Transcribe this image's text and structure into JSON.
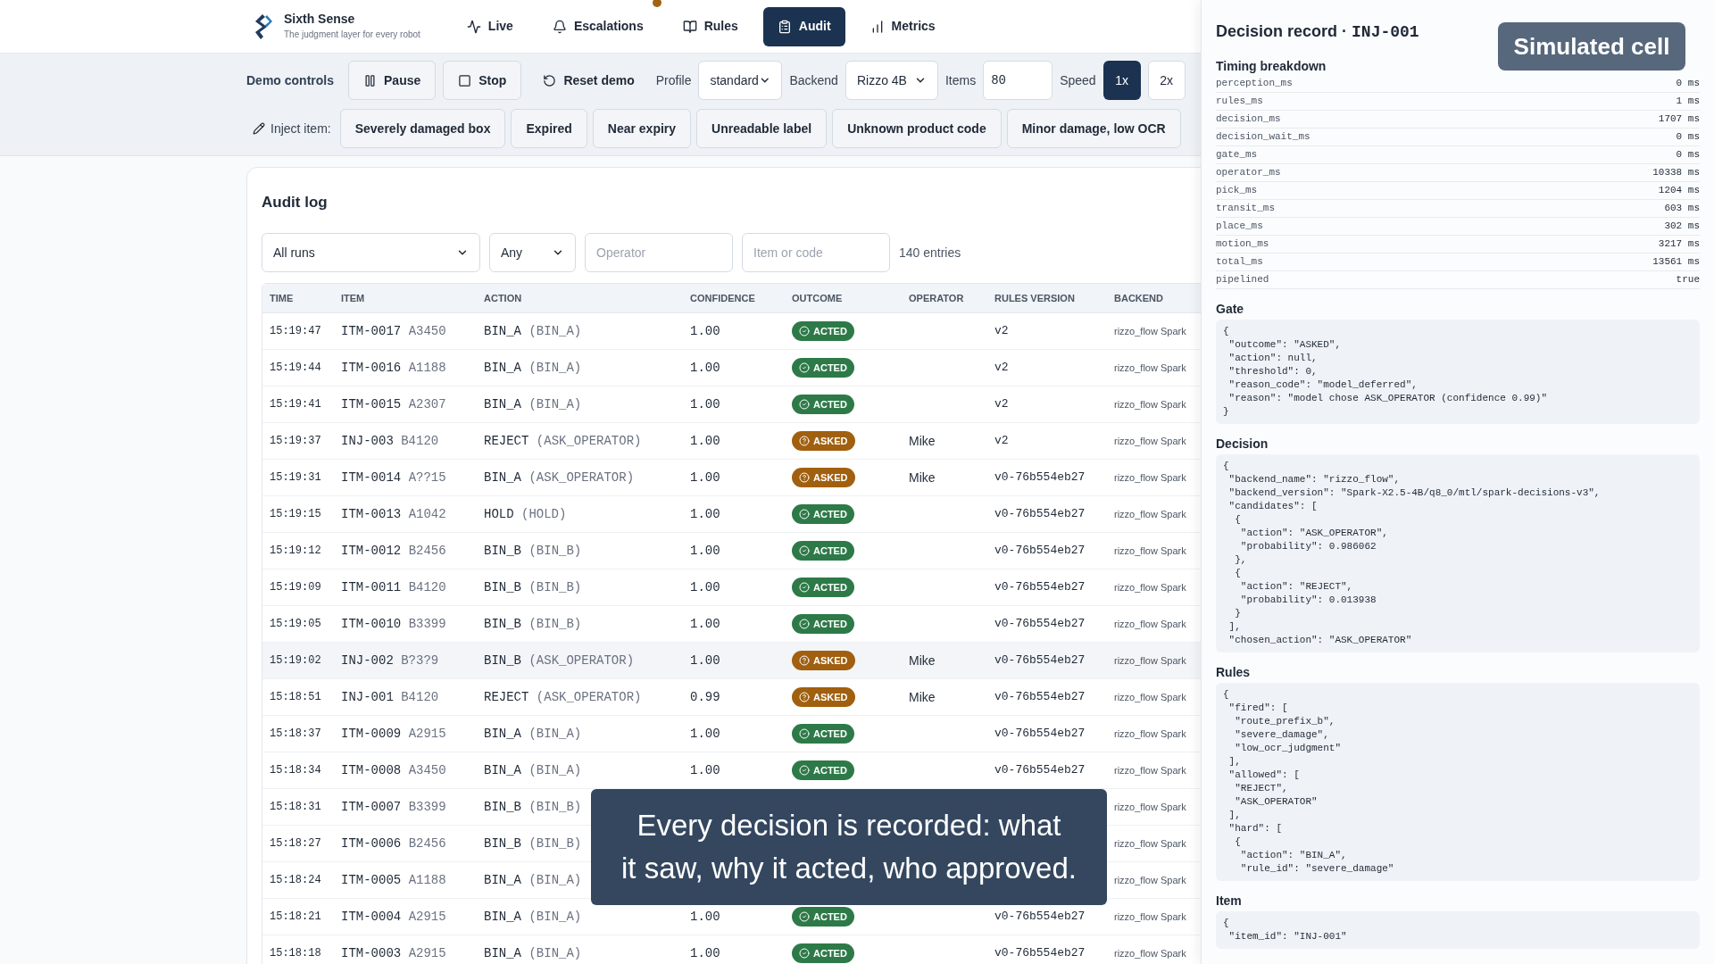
{
  "header": {
    "brand": "Sixth Sense",
    "tagline": "The judgment layer for every robot",
    "tabs": [
      {
        "label": "Live",
        "selected": false,
        "notification": false
      },
      {
        "label": "Escalations",
        "selected": false,
        "notification": true
      },
      {
        "label": "Rules",
        "selected": false,
        "notification": false
      },
      {
        "label": "Audit",
        "selected": true,
        "notification": false
      },
      {
        "label": "Metrics",
        "selected": false,
        "notification": false
      }
    ]
  },
  "demo_controls": {
    "label": "Demo controls",
    "buttons": [
      {
        "label": "Pause",
        "kind": "outlined"
      },
      {
        "label": "Stop",
        "kind": "outlined"
      },
      {
        "label": "Reset demo",
        "kind": "plain"
      }
    ],
    "profile": {
      "label": "Profile",
      "value": "standard"
    },
    "backend": {
      "label": "Backend",
      "value": "Rizzo 4B"
    },
    "items": {
      "label": "Items",
      "value": "80"
    },
    "speed": {
      "label": "Speed",
      "options": [
        {
          "label": "1x",
          "selected": true
        },
        {
          "label": "2x",
          "selected": false
        }
      ]
    },
    "inject": {
      "label": "Inject item:",
      "items": [
        "Severely damaged box",
        "Expired",
        "Near expiry",
        "Unreadable label",
        "Unknown product code",
        "Minor damage, low OCR"
      ]
    }
  },
  "audit_log": {
    "title": "Audit log",
    "filters": {
      "run": "All runs",
      "outcome": "Any",
      "operator_placeholder": "Operator",
      "item_placeholder": "Item or code",
      "count": "140 entries"
    },
    "columns": [
      "TIME",
      "ITEM",
      "ACTION",
      "CONFIDENCE",
      "OUTCOME",
      "OPERATOR",
      "RULES VERSION",
      "BACKEND"
    ],
    "rows": [
      {
        "time": "15:19:47",
        "item": "ITM-0017",
        "code": "A3450",
        "action": "BIN_A",
        "proposed": "(BIN_A)",
        "confidence": "1.00",
        "outcome": "ACTED",
        "kind": "acted",
        "operator": "",
        "rules_version": "v2",
        "backend": "rizzo_flow Spark",
        "selected": false
      },
      {
        "time": "15:19:44",
        "item": "ITM-0016",
        "code": "A1188",
        "action": "BIN_A",
        "proposed": "(BIN_A)",
        "confidence": "1.00",
        "outcome": "ACTED",
        "kind": "acted",
        "operator": "",
        "rules_version": "v2",
        "backend": "rizzo_flow Spark",
        "selected": false
      },
      {
        "time": "15:19:41",
        "item": "ITM-0015",
        "code": "A2307",
        "action": "BIN_A",
        "proposed": "(BIN_A)",
        "confidence": "1.00",
        "outcome": "ACTED",
        "kind": "acted",
        "operator": "",
        "rules_version": "v2",
        "backend": "rizzo_flow Spark",
        "selected": false
      },
      {
        "time": "15:19:37",
        "item": "INJ-003",
        "code": "B4120",
        "action": "REJECT",
        "proposed": "(ASK_OPERATOR)",
        "confidence": "1.00",
        "outcome": "ASKED",
        "kind": "asked",
        "operator": "Mike",
        "rules_version": "v2",
        "backend": "rizzo_flow Spark",
        "selected": false
      },
      {
        "time": "15:19:31",
        "item": "ITM-0014",
        "code": "A??15",
        "action": "BIN_A",
        "proposed": "(ASK_OPERATOR)",
        "confidence": "1.00",
        "outcome": "ASKED",
        "kind": "asked",
        "operator": "Mike",
        "rules_version": "v0-76b554eb27",
        "backend": "rizzo_flow Spark",
        "selected": false
      },
      {
        "time": "15:19:15",
        "item": "ITM-0013",
        "code": "A1042",
        "action": "HOLD",
        "proposed": "(HOLD)",
        "confidence": "1.00",
        "outcome": "ACTED",
        "kind": "acted",
        "operator": "",
        "rules_version": "v0-76b554eb27",
        "backend": "rizzo_flow Spark",
        "selected": false
      },
      {
        "time": "15:19:12",
        "item": "ITM-0012",
        "code": "B2456",
        "action": "BIN_B",
        "proposed": "(BIN_B)",
        "confidence": "1.00",
        "outcome": "ACTED",
        "kind": "acted",
        "operator": "",
        "rules_version": "v0-76b554eb27",
        "backend": "rizzo_flow Spark",
        "selected": false
      },
      {
        "time": "15:19:09",
        "item": "ITM-0011",
        "code": "B4120",
        "action": "BIN_B",
        "proposed": "(BIN_B)",
        "confidence": "1.00",
        "outcome": "ACTED",
        "kind": "acted",
        "operator": "",
        "rules_version": "v0-76b554eb27",
        "backend": "rizzo_flow Spark",
        "selected": false
      },
      {
        "time": "15:19:05",
        "item": "ITM-0010",
        "code": "B3399",
        "action": "BIN_B",
        "proposed": "(BIN_B)",
        "confidence": "1.00",
        "outcome": "ACTED",
        "kind": "acted",
        "operator": "",
        "rules_version": "v0-76b554eb27",
        "backend": "rizzo_flow Spark",
        "selected": false
      },
      {
        "time": "15:19:02",
        "item": "INJ-002",
        "code": "B?3?9",
        "action": "BIN_B",
        "proposed": "(ASK_OPERATOR)",
        "confidence": "1.00",
        "outcome": "ASKED",
        "kind": "asked",
        "operator": "Mike",
        "rules_version": "v0-76b554eb27",
        "backend": "rizzo_flow Spark",
        "selected": true
      },
      {
        "time": "15:18:51",
        "item": "INJ-001",
        "code": "B4120",
        "action": "REJECT",
        "proposed": "(ASK_OPERATOR)",
        "confidence": "0.99",
        "outcome": "ASKED",
        "kind": "asked",
        "operator": "Mike",
        "rules_version": "v0-76b554eb27",
        "backend": "rizzo_flow Spark",
        "selected": false
      },
      {
        "time": "15:18:37",
        "item": "ITM-0009",
        "code": "A2915",
        "action": "BIN_A",
        "proposed": "(BIN_A)",
        "confidence": "1.00",
        "outcome": "ACTED",
        "kind": "acted",
        "operator": "",
        "rules_version": "v0-76b554eb27",
        "backend": "rizzo_flow Spark",
        "selected": false
      },
      {
        "time": "15:18:34",
        "item": "ITM-0008",
        "code": "A3450",
        "action": "BIN_A",
        "proposed": "(BIN_A)",
        "confidence": "1.00",
        "outcome": "ACTED",
        "kind": "acted",
        "operator": "",
        "rules_version": "v0-76b554eb27",
        "backend": "rizzo_flow Spark",
        "selected": false
      },
      {
        "time": "15:18:31",
        "item": "ITM-0007",
        "code": "B3399",
        "action": "BIN_B",
        "proposed": "(BIN_B)",
        "operator": "",
        "backend": "rizzo_flow Spark",
        "selected": false
      },
      {
        "time": "15:18:27",
        "item": "ITM-0006",
        "code": "B2456",
        "action": "BIN_B",
        "proposed": "(BIN_B)",
        "operator": "",
        "backend": "rizzo_flow Spark",
        "selected": false
      },
      {
        "time": "15:18:24",
        "item": "ITM-0005",
        "code": "A1188",
        "action": "BIN_A",
        "proposed": "(BIN_A)",
        "operator": "",
        "backend": "rizzo_flow Spark",
        "selected": false
      },
      {
        "time": "15:18:21",
        "item": "ITM-0004",
        "code": "A2915",
        "action": "BIN_A",
        "proposed": "(BIN_A)",
        "confidence": "1.00",
        "outcome": "ACTED",
        "kind": "acted",
        "operator": "",
        "rules_version": "v0-76b554eb27",
        "backend": "rizzo_flow Spark",
        "selected": false
      },
      {
        "time": "15:18:18",
        "item": "ITM-0003",
        "code": "A2915",
        "action": "BIN_A",
        "proposed": "(BIN_A)",
        "confidence": "1.00",
        "outcome": "ACTED",
        "kind": "acted",
        "operator": "",
        "rules_version": "v0-76b554eb27",
        "backend": "rizzo_flow Spark",
        "selected": false
      }
    ]
  },
  "caption": [
    "Every decision is recorded: what",
    "it saw, why it acted, who approved."
  ],
  "drawer": {
    "title": "Decision record ·",
    "record_id": "INJ-001",
    "badge": "Simulated cell",
    "timing": {
      "title": "Timing breakdown",
      "rows": [
        {
          "key": "perception_ms",
          "value": "0 ms"
        },
        {
          "key": "rules_ms",
          "value": "1 ms"
        },
        {
          "key": "decision_ms",
          "value": "1707 ms"
        },
        {
          "key": "decision_wait_ms",
          "value": "0 ms"
        },
        {
          "key": "gate_ms",
          "value": "0 ms"
        },
        {
          "key": "operator_ms",
          "value": "10338 ms"
        },
        {
          "key": "pick_ms",
          "value": "1204 ms"
        },
        {
          "key": "transit_ms",
          "value": "603 ms"
        },
        {
          "key": "place_ms",
          "value": "302 ms"
        },
        {
          "key": "motion_ms",
          "value": "3217 ms"
        },
        {
          "key": "total_ms",
          "value": "13561 ms"
        },
        {
          "key": "pipelined",
          "value": "true"
        }
      ]
    },
    "sections": [
      {
        "title": "Gate",
        "lines": [
          "{",
          " \"outcome\": \"ASKED\",",
          " \"action\": null,",
          " \"threshold\": 0,",
          " \"reason_code\": \"model_deferred\",",
          " \"reason\": \"model chose ASK_OPERATOR (confidence 0.99)\"",
          "}"
        ]
      },
      {
        "title": "Decision",
        "lines": [
          "{",
          " \"backend_name\": \"rizzo_flow\",",
          " \"backend_version\": \"Spark-X2.5-4B/q8_0/mtl/spark-decisions-v3\",",
          " \"candidates\": [",
          "  {",
          "   \"action\": \"ASK_OPERATOR\",",
          "   \"probability\": 0.986062",
          "  },",
          "  {",
          "   \"action\": \"REJECT\",",
          "   \"probability\": 0.013938",
          "  }",
          " ],",
          " \"chosen_action\": \"ASK_OPERATOR\""
        ]
      },
      {
        "title": "Rules",
        "lines": [
          "{",
          " \"fired\": [",
          "  \"route_prefix_b\",",
          "  \"severe_damage\",",
          "  \"low_ocr_judgment\"",
          " ],",
          " \"allowed\": [",
          "  \"REJECT\",",
          "  \"ASK_OPERATOR\"",
          " ],",
          " \"hard\": [",
          "  {",
          "   \"action\": \"BIN_A\",",
          "   \"rule_id\": \"severe_damage\""
        ]
      },
      {
        "title": "Item",
        "lines": [
          "{",
          " \"item_id\": \"INJ-001\""
        ]
      }
    ]
  }
}
